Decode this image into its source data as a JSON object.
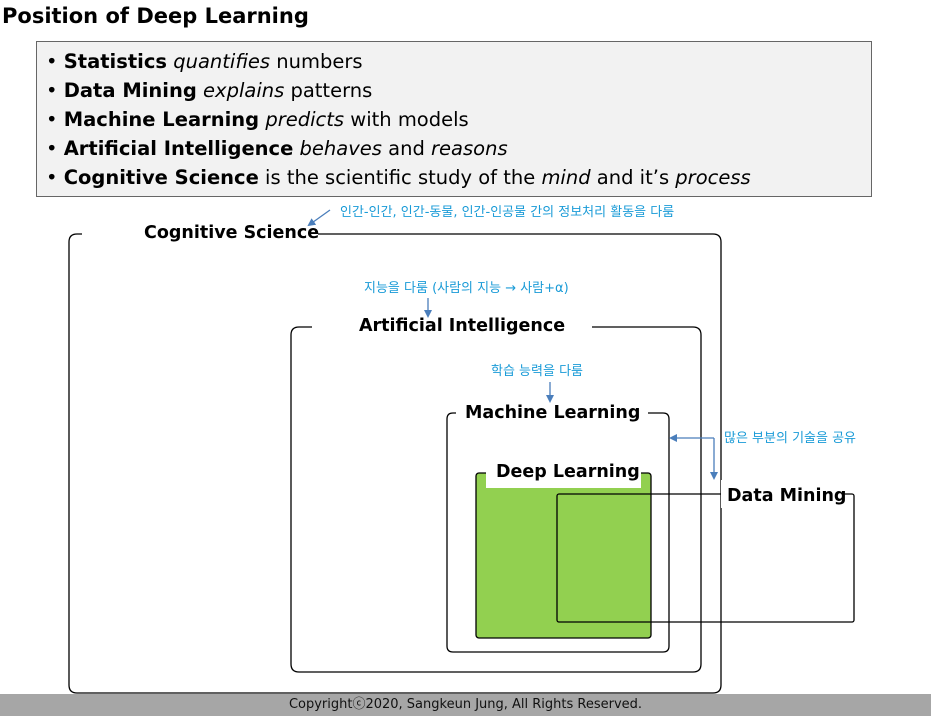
{
  "title": "Position of Deep Learning",
  "bullets": [
    {
      "b1": "Statistics",
      "t1": " ",
      "i1": "quantifies",
      "t2": " numbers",
      "i2": "",
      "t3": ""
    },
    {
      "b1": "Data Mining",
      "t1": " ",
      "i1": "explains",
      "t2": " patterns",
      "i2": "",
      "t3": ""
    },
    {
      "b1": "Machine Learning",
      "t1": " ",
      "i1": "predicts",
      "t2": " with models",
      "i2": "",
      "t3": ""
    },
    {
      "b1": "Artificial Intelligence",
      "t1": " ",
      "i1": "behaves",
      "t2": " and ",
      "i2": "reasons",
      "t3": ""
    },
    {
      "b1": "Cognitive Science",
      "t1": " is the scientific study of the ",
      "i1": "mind",
      "t2": " and it’s ",
      "i2": "process",
      "t3": ""
    }
  ],
  "diagram": {
    "labels": {
      "cognitive_science": "Cognitive Science",
      "artificial_intelligence": "Artificial Intelligence",
      "machine_learning": "Machine Learning",
      "deep_learning": "Deep Learning",
      "data_mining": "Data Mining"
    },
    "notes": {
      "cognitive_science": "인간-인간, 인간-동물, 인간-인공물 간의 정보처리 활동을 다룸",
      "artificial_intelligence": "지능을 다룸 (사람의 지능 → 사람+α)",
      "machine_learning": "학습 능력을 다룸",
      "data_mining": "많은 부분의 기술을 공유"
    },
    "colors": {
      "deep_learning_fill": "#92d050",
      "note_text": "#1a9bd7",
      "arrow": "#4a7ebb",
      "frame": "#000000"
    }
  },
  "footer": "Copyrightⓒ2020, Sangkeun Jung, All Rights Reserved."
}
